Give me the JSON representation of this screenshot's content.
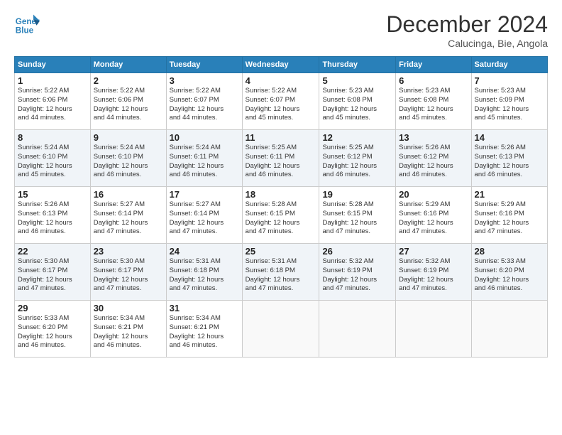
{
  "header": {
    "logo_line1": "General",
    "logo_line2": "Blue",
    "month": "December 2024",
    "location": "Calucinga, Bie, Angola"
  },
  "weekdays": [
    "Sunday",
    "Monday",
    "Tuesday",
    "Wednesday",
    "Thursday",
    "Friday",
    "Saturday"
  ],
  "weeks": [
    [
      {
        "day": "1",
        "rise": "5:22 AM",
        "set": "6:06 PM",
        "daylight": "12 hours and 44 minutes."
      },
      {
        "day": "2",
        "rise": "5:22 AM",
        "set": "6:06 PM",
        "daylight": "12 hours and 44 minutes."
      },
      {
        "day": "3",
        "rise": "5:22 AM",
        "set": "6:07 PM",
        "daylight": "12 hours and 44 minutes."
      },
      {
        "day": "4",
        "rise": "5:22 AM",
        "set": "6:07 PM",
        "daylight": "12 hours and 45 minutes."
      },
      {
        "day": "5",
        "rise": "5:23 AM",
        "set": "6:08 PM",
        "daylight": "12 hours and 45 minutes."
      },
      {
        "day": "6",
        "rise": "5:23 AM",
        "set": "6:08 PM",
        "daylight": "12 hours and 45 minutes."
      },
      {
        "day": "7",
        "rise": "5:23 AM",
        "set": "6:09 PM",
        "daylight": "12 hours and 45 minutes."
      }
    ],
    [
      {
        "day": "8",
        "rise": "5:24 AM",
        "set": "6:10 PM",
        "daylight": "12 hours and 45 minutes."
      },
      {
        "day": "9",
        "rise": "5:24 AM",
        "set": "6:10 PM",
        "daylight": "12 hours and 46 minutes."
      },
      {
        "day": "10",
        "rise": "5:24 AM",
        "set": "6:11 PM",
        "daylight": "12 hours and 46 minutes."
      },
      {
        "day": "11",
        "rise": "5:25 AM",
        "set": "6:11 PM",
        "daylight": "12 hours and 46 minutes."
      },
      {
        "day": "12",
        "rise": "5:25 AM",
        "set": "6:12 PM",
        "daylight": "12 hours and 46 minutes."
      },
      {
        "day": "13",
        "rise": "5:26 AM",
        "set": "6:12 PM",
        "daylight": "12 hours and 46 minutes."
      },
      {
        "day": "14",
        "rise": "5:26 AM",
        "set": "6:13 PM",
        "daylight": "12 hours and 46 minutes."
      }
    ],
    [
      {
        "day": "15",
        "rise": "5:26 AM",
        "set": "6:13 PM",
        "daylight": "12 hours and 46 minutes."
      },
      {
        "day": "16",
        "rise": "5:27 AM",
        "set": "6:14 PM",
        "daylight": "12 hours and 47 minutes."
      },
      {
        "day": "17",
        "rise": "5:27 AM",
        "set": "6:14 PM",
        "daylight": "12 hours and 47 minutes."
      },
      {
        "day": "18",
        "rise": "5:28 AM",
        "set": "6:15 PM",
        "daylight": "12 hours and 47 minutes."
      },
      {
        "day": "19",
        "rise": "5:28 AM",
        "set": "6:15 PM",
        "daylight": "12 hours and 47 minutes."
      },
      {
        "day": "20",
        "rise": "5:29 AM",
        "set": "6:16 PM",
        "daylight": "12 hours and 47 minutes."
      },
      {
        "day": "21",
        "rise": "5:29 AM",
        "set": "6:16 PM",
        "daylight": "12 hours and 47 minutes."
      }
    ],
    [
      {
        "day": "22",
        "rise": "5:30 AM",
        "set": "6:17 PM",
        "daylight": "12 hours and 47 minutes."
      },
      {
        "day": "23",
        "rise": "5:30 AM",
        "set": "6:17 PM",
        "daylight": "12 hours and 47 minutes."
      },
      {
        "day": "24",
        "rise": "5:31 AM",
        "set": "6:18 PM",
        "daylight": "12 hours and 47 minutes."
      },
      {
        "day": "25",
        "rise": "5:31 AM",
        "set": "6:18 PM",
        "daylight": "12 hours and 47 minutes."
      },
      {
        "day": "26",
        "rise": "5:32 AM",
        "set": "6:19 PM",
        "daylight": "12 hours and 47 minutes."
      },
      {
        "day": "27",
        "rise": "5:32 AM",
        "set": "6:19 PM",
        "daylight": "12 hours and 47 minutes."
      },
      {
        "day": "28",
        "rise": "5:33 AM",
        "set": "6:20 PM",
        "daylight": "12 hours and 46 minutes."
      }
    ],
    [
      {
        "day": "29",
        "rise": "5:33 AM",
        "set": "6:20 PM",
        "daylight": "12 hours and 46 minutes."
      },
      {
        "day": "30",
        "rise": "5:34 AM",
        "set": "6:21 PM",
        "daylight": "12 hours and 46 minutes."
      },
      {
        "day": "31",
        "rise": "5:34 AM",
        "set": "6:21 PM",
        "daylight": "12 hours and 46 minutes."
      },
      null,
      null,
      null,
      null
    ]
  ]
}
